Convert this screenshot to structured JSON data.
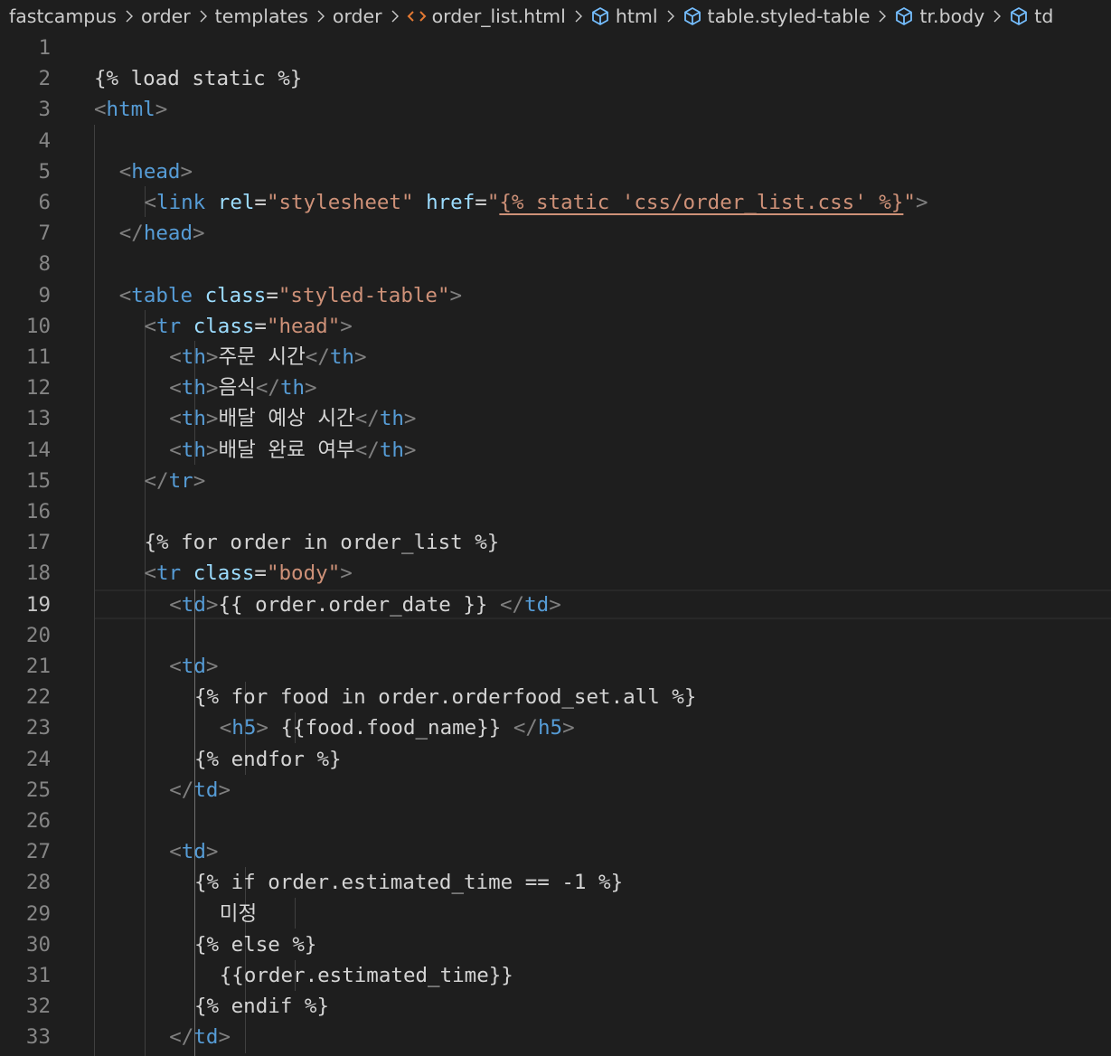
{
  "breadcrumb": {
    "items": [
      {
        "label": "fastcampus",
        "icon": "none"
      },
      {
        "label": "order",
        "icon": "none"
      },
      {
        "label": "templates",
        "icon": "none"
      },
      {
        "label": "order",
        "icon": "none"
      },
      {
        "label": "order_list.html",
        "icon": "html-file-icon"
      },
      {
        "label": "html",
        "icon": "cube-icon"
      },
      {
        "label": "table.styled-table",
        "icon": "cube-icon"
      },
      {
        "label": "tr.body",
        "icon": "cube-icon"
      },
      {
        "label": "td",
        "icon": "cube-icon"
      }
    ],
    "separator_icon": "chevron-right-icon"
  },
  "colors": {
    "background": "#1e1e1e",
    "tag": "#569cd6",
    "bracket": "#808080",
    "attribute": "#9cdcfe",
    "string": "#ce9178",
    "text": "#d4d4d4",
    "line_number": "#858585",
    "html_file_icon": "#e37933",
    "symbol_icon": "#75beff"
  },
  "editor": {
    "active_line": 19,
    "lines": [
      {
        "n": "1",
        "tokens": []
      },
      {
        "n": "2",
        "tokens": [
          {
            "t": "txt",
            "v": "{% load static %}"
          }
        ]
      },
      {
        "n": "3",
        "tokens": [
          {
            "t": "br",
            "v": "<"
          },
          {
            "t": "tag",
            "v": "html"
          },
          {
            "t": "br",
            "v": ">"
          }
        ]
      },
      {
        "n": "4",
        "tokens": []
      },
      {
        "n": "5",
        "tokens": [
          {
            "t": "br",
            "v": "<"
          },
          {
            "t": "tag",
            "v": "head"
          },
          {
            "t": "br",
            "v": ">"
          }
        ]
      },
      {
        "n": "6",
        "tokens": [
          {
            "t": "br",
            "v": "<"
          },
          {
            "t": "tag",
            "v": "link"
          },
          {
            "t": "txt",
            "v": " "
          },
          {
            "t": "att",
            "v": "rel"
          },
          {
            "t": "txt",
            "v": "="
          },
          {
            "t": "str",
            "v": "\"stylesheet\""
          },
          {
            "t": "txt",
            "v": " "
          },
          {
            "t": "att",
            "v": "href"
          },
          {
            "t": "txt",
            "v": "="
          },
          {
            "t": "str",
            "v": "\""
          },
          {
            "t": "strw",
            "v": "{% static 'css/order_list.css' %}"
          },
          {
            "t": "str",
            "v": "\""
          },
          {
            "t": "br",
            "v": ">"
          }
        ]
      },
      {
        "n": "7",
        "tokens": [
          {
            "t": "br",
            "v": "</"
          },
          {
            "t": "tag",
            "v": "head"
          },
          {
            "t": "br",
            "v": ">"
          }
        ]
      },
      {
        "n": "8",
        "tokens": []
      },
      {
        "n": "9",
        "tokens": [
          {
            "t": "br",
            "v": "<"
          },
          {
            "t": "tag",
            "v": "table"
          },
          {
            "t": "txt",
            "v": " "
          },
          {
            "t": "att",
            "v": "class"
          },
          {
            "t": "txt",
            "v": "="
          },
          {
            "t": "str",
            "v": "\"styled-table\""
          },
          {
            "t": "br",
            "v": ">"
          }
        ]
      },
      {
        "n": "10",
        "tokens": [
          {
            "t": "br",
            "v": "<"
          },
          {
            "t": "tag",
            "v": "tr"
          },
          {
            "t": "txt",
            "v": " "
          },
          {
            "t": "att",
            "v": "class"
          },
          {
            "t": "txt",
            "v": "="
          },
          {
            "t": "str",
            "v": "\"head\""
          },
          {
            "t": "br",
            "v": ">"
          }
        ]
      },
      {
        "n": "11",
        "tokens": [
          {
            "t": "br",
            "v": "<"
          },
          {
            "t": "tag",
            "v": "th"
          },
          {
            "t": "br",
            "v": ">"
          },
          {
            "t": "txt",
            "v": "주문 시간"
          },
          {
            "t": "br",
            "v": "</"
          },
          {
            "t": "tag",
            "v": "th"
          },
          {
            "t": "br",
            "v": ">"
          }
        ]
      },
      {
        "n": "12",
        "tokens": [
          {
            "t": "br",
            "v": "<"
          },
          {
            "t": "tag",
            "v": "th"
          },
          {
            "t": "br",
            "v": ">"
          },
          {
            "t": "txt",
            "v": "음식"
          },
          {
            "t": "br",
            "v": "</"
          },
          {
            "t": "tag",
            "v": "th"
          },
          {
            "t": "br",
            "v": ">"
          }
        ]
      },
      {
        "n": "13",
        "tokens": [
          {
            "t": "br",
            "v": "<"
          },
          {
            "t": "tag",
            "v": "th"
          },
          {
            "t": "br",
            "v": ">"
          },
          {
            "t": "txt",
            "v": "배달 예상 시간"
          },
          {
            "t": "br",
            "v": "</"
          },
          {
            "t": "tag",
            "v": "th"
          },
          {
            "t": "br",
            "v": ">"
          }
        ]
      },
      {
        "n": "14",
        "tokens": [
          {
            "t": "br",
            "v": "<"
          },
          {
            "t": "tag",
            "v": "th"
          },
          {
            "t": "br",
            "v": ">"
          },
          {
            "t": "txt",
            "v": "배달 완료 여부"
          },
          {
            "t": "br",
            "v": "</"
          },
          {
            "t": "tag",
            "v": "th"
          },
          {
            "t": "br",
            "v": ">"
          }
        ]
      },
      {
        "n": "15",
        "tokens": [
          {
            "t": "br",
            "v": "</"
          },
          {
            "t": "tag",
            "v": "tr"
          },
          {
            "t": "br",
            "v": ">"
          }
        ]
      },
      {
        "n": "16",
        "tokens": []
      },
      {
        "n": "17",
        "tokens": [
          {
            "t": "txt",
            "v": "{% for order in order_list %}"
          }
        ]
      },
      {
        "n": "18",
        "tokens": [
          {
            "t": "br",
            "v": "<"
          },
          {
            "t": "tag",
            "v": "tr"
          },
          {
            "t": "txt",
            "v": " "
          },
          {
            "t": "att",
            "v": "class"
          },
          {
            "t": "txt",
            "v": "="
          },
          {
            "t": "str",
            "v": "\"body\""
          },
          {
            "t": "br",
            "v": ">"
          }
        ]
      },
      {
        "n": "19",
        "tokens": [
          {
            "t": "br",
            "v": "<"
          },
          {
            "t": "tag",
            "v": "td"
          },
          {
            "t": "br",
            "v": ">"
          },
          {
            "t": "txt",
            "v": "{{ order.order_date }} "
          },
          {
            "t": "br",
            "v": "</"
          },
          {
            "t": "tag",
            "v": "td"
          },
          {
            "t": "br",
            "v": ">"
          }
        ]
      },
      {
        "n": "20",
        "tokens": []
      },
      {
        "n": "21",
        "tokens": [
          {
            "t": "br",
            "v": "<"
          },
          {
            "t": "tag",
            "v": "td"
          },
          {
            "t": "br",
            "v": ">"
          }
        ]
      },
      {
        "n": "22",
        "tokens": [
          {
            "t": "txt",
            "v": "{% for food in order.orderfood_set.all %}"
          }
        ]
      },
      {
        "n": "23",
        "tokens": [
          {
            "t": "br",
            "v": "<"
          },
          {
            "t": "tag",
            "v": "h5"
          },
          {
            "t": "br",
            "v": ">"
          },
          {
            "t": "txt",
            "v": " {{food.food_name}} "
          },
          {
            "t": "br",
            "v": "</"
          },
          {
            "t": "tag",
            "v": "h5"
          },
          {
            "t": "br",
            "v": ">"
          }
        ]
      },
      {
        "n": "24",
        "tokens": [
          {
            "t": "txt",
            "v": "{% endfor %}"
          }
        ]
      },
      {
        "n": "25",
        "tokens": [
          {
            "t": "br",
            "v": "</"
          },
          {
            "t": "tag",
            "v": "td"
          },
          {
            "t": "br",
            "v": ">"
          }
        ]
      },
      {
        "n": "26",
        "tokens": []
      },
      {
        "n": "27",
        "tokens": [
          {
            "t": "br",
            "v": "<"
          },
          {
            "t": "tag",
            "v": "td"
          },
          {
            "t": "br",
            "v": ">"
          }
        ]
      },
      {
        "n": "28",
        "tokens": [
          {
            "t": "txt",
            "v": "{% if order.estimated_time == -1 %}"
          }
        ]
      },
      {
        "n": "29",
        "tokens": [
          {
            "t": "txt",
            "v": "미정"
          }
        ]
      },
      {
        "n": "30",
        "tokens": [
          {
            "t": "txt",
            "v": "{% else %}"
          }
        ]
      },
      {
        "n": "31",
        "tokens": [
          {
            "t": "txt",
            "v": "{{order.estimated_time}}"
          }
        ]
      },
      {
        "n": "32",
        "tokens": [
          {
            "t": "txt",
            "v": "{% endif %}"
          }
        ]
      },
      {
        "n": "33",
        "tokens": [
          {
            "t": "br",
            "v": "</"
          },
          {
            "t": "tag",
            "v": "td"
          },
          {
            "t": "br",
            "v": ">"
          }
        ]
      }
    ]
  }
}
